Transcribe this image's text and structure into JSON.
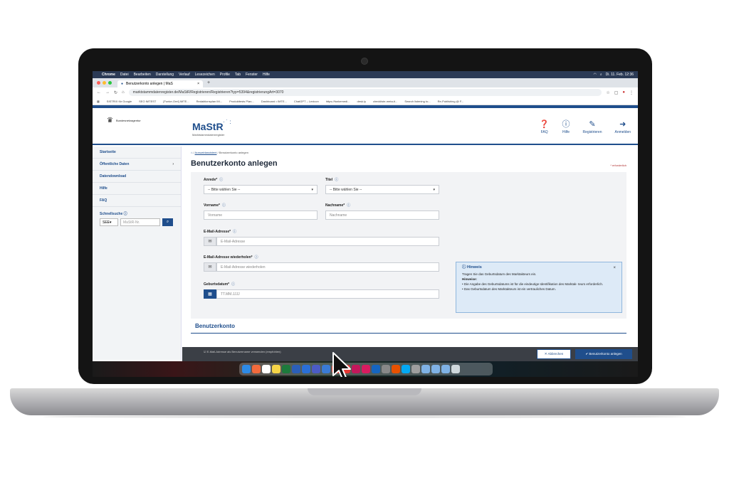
{
  "menubar": {
    "app": "Chrome",
    "items": [
      "Datei",
      "Bearbeiten",
      "Darstellung",
      "Verlauf",
      "Lesezeichen",
      "Profile",
      "Tab",
      "Fenster",
      "Hilfe"
    ],
    "clock": "Di. 11. Feb. 12:36"
  },
  "browser": {
    "tab_title": "Benutzerkonto anlegen | MaS",
    "url": "marktstammdatenregister.de/MaStR/Registrieren/Registrieren?typ=5394&registrierungArt=3070",
    "bookmarks": [
      "SISTRIX für Google",
      "SEO IMTEST",
      "[Funke-Orel] IMTE...",
      "Redaktionsplan IM...",
      "Produkttests Plan...",
      "Dashboard • IMTE...",
      "ChatGPT – Lexicon",
      "https://funkemedi...",
      "desk.ly",
      "checkliste-meta-ti...",
      "Search listening to...",
      "Re-Publishing @ F..."
    ]
  },
  "header": {
    "agency": "Bundesnetzagentur",
    "logo": "MaStR",
    "logo_sub": "Marktstammdatenregister",
    "nav": [
      {
        "label": "FAQ",
        "icon": "question-circle-icon"
      },
      {
        "label": "Hilfe",
        "icon": "info-circle-icon"
      },
      {
        "label": "Registrieren",
        "icon": "edit-icon"
      },
      {
        "label": "Anmelden",
        "icon": "sign-in-icon"
      }
    ]
  },
  "sidebar": {
    "items": [
      {
        "label": "Startseite"
      },
      {
        "label": "Öffentliche Daten"
      },
      {
        "label": "Datendownload"
      },
      {
        "label": "Hilfe"
      },
      {
        "label": "FAQ"
      }
    ],
    "quicksearch_label": "Schnellsuche",
    "quicksearch_select": "SEE",
    "quicksearch_placeholder": "MaStR-Nr."
  },
  "main": {
    "breadcrumb": [
      "Auswahlassistent",
      "Benutzerkonto anlegen"
    ],
    "title": "Benutzerkonto anlegen",
    "required_note": "* erforderlich",
    "fields": {
      "anrede_label": "Anrede*",
      "anrede_value": "-- Bitte wählen Sie --",
      "titel_label": "Titel",
      "titel_value": "-- Bitte wählen Sie --",
      "vorname_label": "Vorname*",
      "vorname_placeholder": "Vorname",
      "nachname_label": "Nachname*",
      "nachname_placeholder": "Nachname",
      "email_label": "E-Mail-Adresse*",
      "email_placeholder": "E-Mail-Adresse",
      "email2_label": "E-Mail-Adresse wiederholen*",
      "email2_placeholder": "E-Mail-Adresse wiederholen",
      "geburt_label": "Geburtsdatum*",
      "geburt_placeholder": "TT.MM.JJJJ"
    },
    "hint": {
      "title": "Hinweis",
      "line1": "Tragen Sie das Geburtsdatum des Marktakteurs ein.",
      "line2": "Hinweise:",
      "line3": "• Die Angabe des Geburtsdatums ist für die eindeutige Identifikation des Marktak- teurs erforderlich.",
      "line4": "• Das Geburtsdatum des Marktakteurs ist ein vertrauliches Datum."
    },
    "section_title": "Benutzerkonto",
    "footer_checkbox": "E-Mail-Adresse als Benutzername verwenden (empfohlen)",
    "cancel_label": "✕ Abbrechen",
    "create_label": "✔ Benutzerkonto anlegen"
  }
}
